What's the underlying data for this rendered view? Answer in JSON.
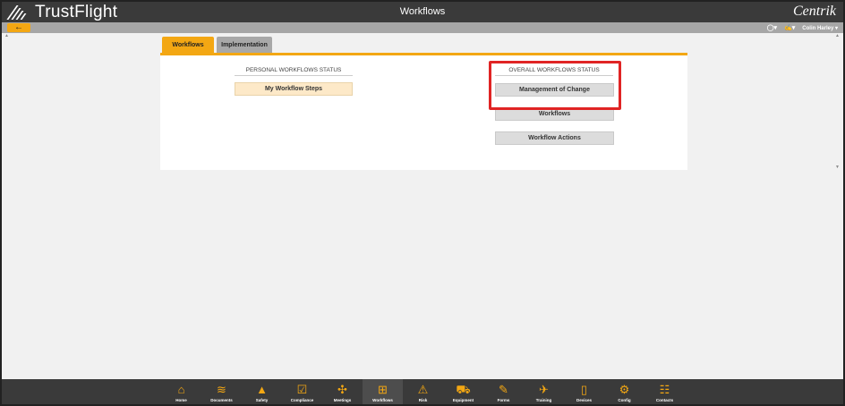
{
  "header": {
    "brand": "TrustFlight",
    "title": "Workflows",
    "vendor": "Centrik"
  },
  "subbar": {
    "back_icon": "arrow-left-icon",
    "user_name": "Colin Harley",
    "user_caret": "▾",
    "bulb_icon": "lightbulb-icon",
    "notify_icon": "megaphone-icon"
  },
  "tabs": [
    {
      "label": "Workflows",
      "active": true
    },
    {
      "label": "Implementation",
      "active": false
    }
  ],
  "personal": {
    "heading": "PERSONAL WORKFLOWS STATUS",
    "buttons": [
      "My Workflow Steps"
    ]
  },
  "overall": {
    "heading": "OVERALL WORKFLOWS STATUS",
    "buttons": [
      "Management of Change",
      "Workflows",
      "Workflow Actions"
    ]
  },
  "dock": [
    {
      "label": "Home",
      "icon": "home-icon",
      "glyph": "⌂"
    },
    {
      "label": "Documents",
      "icon": "documents-icon",
      "glyph": "≋"
    },
    {
      "label": "Safety",
      "icon": "cone-icon",
      "glyph": "▲"
    },
    {
      "label": "Compliance",
      "icon": "compliance-icon",
      "glyph": "☑"
    },
    {
      "label": "Meetings",
      "icon": "meetings-icon",
      "glyph": "✣"
    },
    {
      "label": "Workflows",
      "icon": "workflows-icon",
      "glyph": "⊞",
      "active": true
    },
    {
      "label": "Risk",
      "icon": "warning-icon",
      "glyph": "⚠"
    },
    {
      "label": "Equipment",
      "icon": "equipment-icon",
      "glyph": "⛟"
    },
    {
      "label": "Forms",
      "icon": "forms-icon",
      "glyph": "✎"
    },
    {
      "label": "Training",
      "icon": "training-icon",
      "glyph": "✈"
    },
    {
      "label": "Devices",
      "icon": "devices-icon",
      "glyph": "▯"
    },
    {
      "label": "Config",
      "icon": "gear-icon",
      "glyph": "⚙"
    },
    {
      "label": "Contacts",
      "icon": "contacts-icon",
      "glyph": "☷"
    }
  ],
  "colors": {
    "accent": "#f3a713",
    "topbar": "#3a3a3a",
    "highlight": "#e02424"
  }
}
